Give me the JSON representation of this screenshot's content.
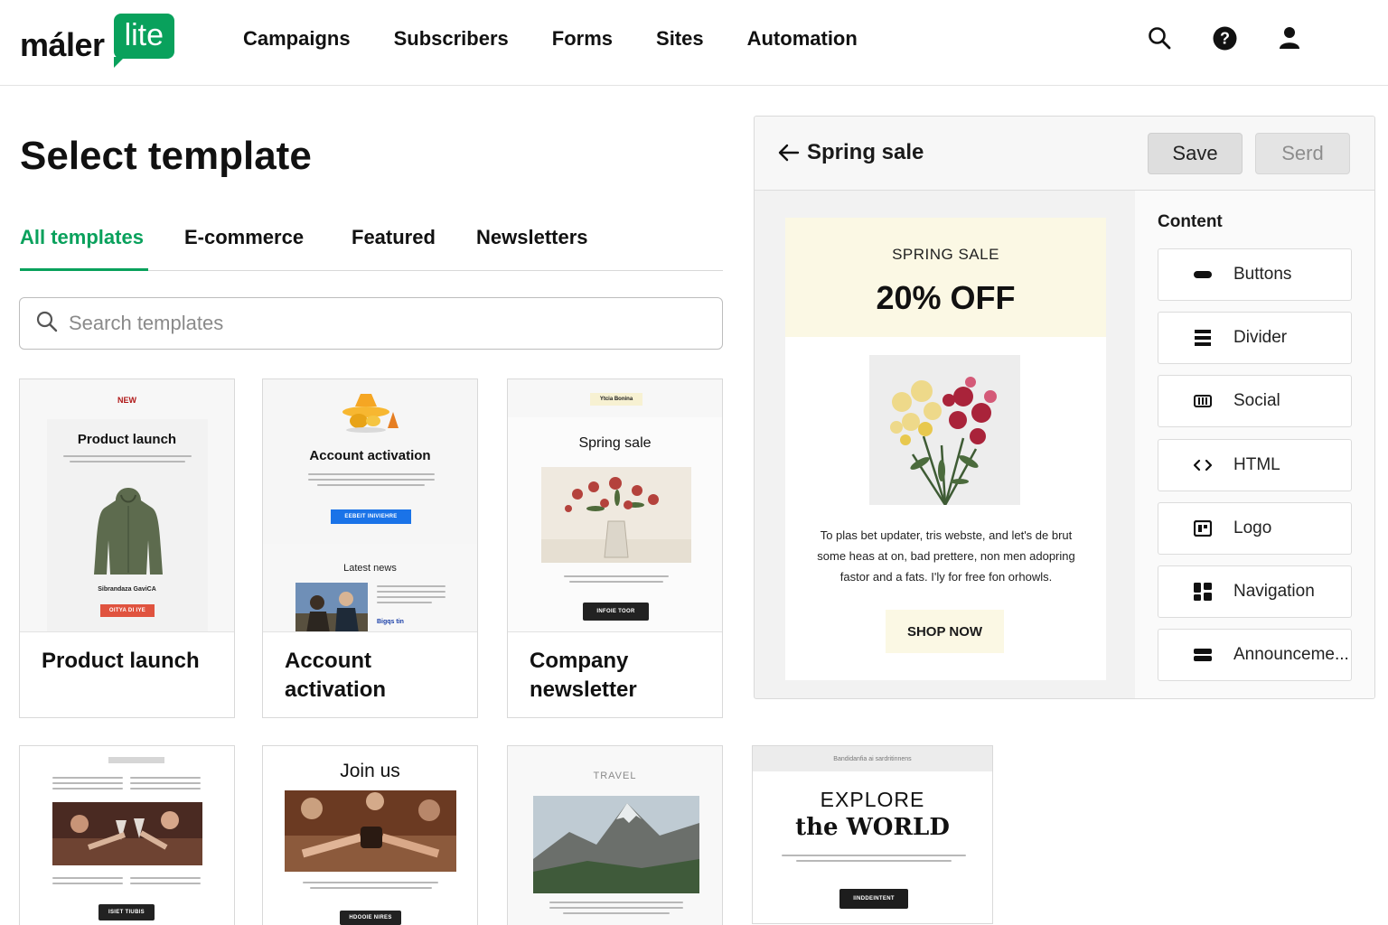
{
  "app": {
    "logo_word": "máler",
    "logo_badge": "lite"
  },
  "nav": {
    "items": [
      "Campaigns",
      "Subscribers",
      "Forms",
      "Sites",
      "Automation"
    ]
  },
  "page": {
    "title": "Select template"
  },
  "tabs": [
    "All templates",
    "E-commerce",
    "Featured",
    "Newsletters"
  ],
  "active_tab": "All templates",
  "search": {
    "placeholder": "Search templates"
  },
  "templates": [
    {
      "name": "Product launch",
      "thumb": {
        "badge": "NEW",
        "heading": "Product launch",
        "caption": "Sibrandaza GaviCA",
        "button": "OITYA DI IYE"
      }
    },
    {
      "name": "Account activation",
      "thumb": {
        "heading": "Account activation",
        "button": "EEBEIT INIVIEHRE",
        "section": "Latest news",
        "link": "Bigqs tin"
      }
    },
    {
      "name": "Company newsletter",
      "thumb": {
        "badge": "Ytcia Bonina",
        "heading": "Spring sale",
        "button": "INFOIE TOOR"
      }
    },
    {
      "name": "",
      "thumb": {
        "button": "ISIET TIUBIS"
      }
    },
    {
      "name": "",
      "thumb": {
        "heading": "Join us",
        "button": "HDOOIE NIRES"
      }
    },
    {
      "name": "",
      "thumb": {
        "kicker": "TRAVEL"
      }
    },
    {
      "name": "",
      "thumb": {
        "top": "Bandidanfia ai sardritinnens",
        "heading_line1": "EXPLORE",
        "heading_line2": "the WORLD",
        "button": "IINDDEINTENT"
      }
    }
  ],
  "editor": {
    "title": "Spring sale",
    "save_label": "Save",
    "send_label": "Serd",
    "email": {
      "kicker": "SPRING SALE",
      "headline": "20% OFF",
      "body": "To plas bet updater, tris webste, and let's de brut some heas at on, bad prettere, non men adopring fastor and a fats. I'ly for free fon orhowls.",
      "cta": "SHOP NOW"
    },
    "content_title": "Content",
    "blocks": [
      {
        "label": "Buttons",
        "icon": "button-block-icon"
      },
      {
        "label": "Divider",
        "icon": "divider-block-icon"
      },
      {
        "label": "Social",
        "icon": "social-block-icon"
      },
      {
        "label": "HTML",
        "icon": "code-icon"
      },
      {
        "label": "Logo",
        "icon": "logo-block-icon"
      },
      {
        "label": "Navigation",
        "icon": "navigation-block-icon"
      },
      {
        "label": "Announceme...",
        "icon": "announcement-block-icon"
      }
    ]
  },
  "colors": {
    "brand_green": "#09a15c",
    "hero_cream": "#fbf8e4",
    "red_button": "#e0533f",
    "blue_button": "#1a73e8",
    "dark_button": "#222222"
  }
}
